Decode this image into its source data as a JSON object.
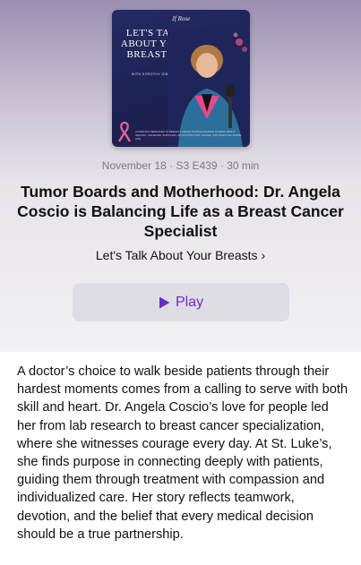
{
  "artwork": {
    "logo": "Jf Rose",
    "title_lines": [
      "LET'S TALK",
      "ABOUT YOUR",
      "BREASTS™"
    ],
    "host_line": "WITH DOROTHY GIBBONS",
    "footer_text": "A PODCAST DEDICATED TO BREAST CANCER. PEOPLE SHARING STORIES ABOUT HEALING, CHANGING, SURVIVING, ADVOCATING FOR CHANGE, AND WHICH ALL SHARE LIFE.",
    "colors": {
      "background": "#1f2558",
      "ribbon": "#e7649a"
    }
  },
  "episode": {
    "meta": "November 18 · S3 E439 · 30 min",
    "title": "Tumor Boards and Motherhood: Dr. Angela Coscio is Balancing Life as a Breast Cancer Specialist",
    "show_link": "Let's Talk About Your Breasts",
    "show_link_chevron": "›",
    "play_label": "Play",
    "play_icon": "play-icon",
    "accent_color": "#6a2ec6",
    "description": "A doctor’s choice to walk beside patients through their hardest moments comes from a calling to serve with both skill and heart. Dr. Angela Coscio’s love for people led her from lab research to breast cancer specialization, where she witnesses courage every day. At St. Luke’s, she finds purpose in connecting deeply with patients, guiding them through treatment with compassion and individualized care. Her story reflects teamwork, devotion, and the belief that every medical decision should be a true partnership."
  }
}
